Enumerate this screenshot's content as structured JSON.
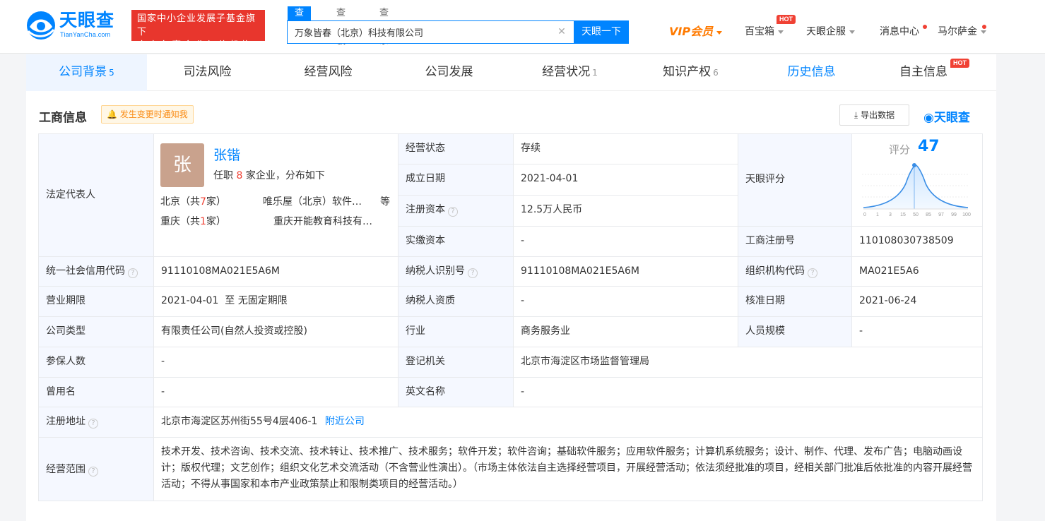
{
  "header": {
    "logo_text": "天眼查",
    "logo_sub": "TianYanCha.com",
    "badge_line1": "国家中小企业发展子基金旗下",
    "badge_line2": "官方备案企业征信机构",
    "search_tabs": [
      "查公司",
      "查老板",
      "查关系"
    ],
    "search_value": "万象皆春（北京）科技有限公司",
    "search_button": "天眼一下",
    "nav": {
      "vip": "VIP会员",
      "baibaoxiang": "百宝箱",
      "hot": "HOT",
      "qifu": "天眼企服",
      "messages": "消息中心",
      "user": "马尔萨金"
    }
  },
  "tabs": [
    {
      "label": "公司背景",
      "count": "5"
    },
    {
      "label": "司法风险",
      "count": ""
    },
    {
      "label": "经营风险",
      "count": ""
    },
    {
      "label": "公司发展",
      "count": ""
    },
    {
      "label": "经营状况",
      "count": "1"
    },
    {
      "label": "知识产权",
      "count": "6"
    },
    {
      "label": "历史信息",
      "count": ""
    },
    {
      "label": "自主信息",
      "count": ""
    }
  ],
  "section": {
    "title": "工商信息",
    "notify": "发生变更时通知我",
    "export": "导出数据",
    "brand": "天眼查"
  },
  "legal_rep": {
    "label": "法定代表人",
    "avatar_char": "张",
    "name": "张锴",
    "sub_pre": "任职",
    "sub_num": "8",
    "sub_post": "家企业，分布如下",
    "row1_city": "北京（共",
    "row1_num": "7",
    "row1_end": "家）",
    "row1_company": "唯乐屋（北京）软件…",
    "row1_more": "等",
    "row2_city": "重庆（共",
    "row2_num": "1",
    "row2_end": "家）",
    "row2_company": "重庆开能教育科技有…"
  },
  "fields": {
    "status_label": "经营状态",
    "status": "存续",
    "found_label": "成立日期",
    "found": "2021-04-01",
    "regcap_label": "注册资本",
    "regcap": "12.5万人民币",
    "paidcap_label": "实缴资本",
    "paidcap": "-",
    "score_label": "天眼评分",
    "score_word": "评分",
    "score": "47",
    "regno_label": "工商注册号",
    "regno": "110108030738509",
    "credit_label": "统一社会信用代码",
    "credit": "91110108MA021E5A6M",
    "taxid_label": "纳税人识别号",
    "taxid": "91110108MA021E5A6M",
    "orgcode_label": "组织机构代码",
    "orgcode": "MA021E5A6",
    "term_label": "营业期限",
    "term": "2021-04-01  至 无固定期限",
    "taxq_label": "纳税人资质",
    "taxq": "-",
    "approve_label": "核准日期",
    "approve": "2021-06-24",
    "type_label": "公司类型",
    "type": "有限责任公司(自然人投资或控股)",
    "industry_label": "行业",
    "industry": "商务服务业",
    "staff_label": "人员规模",
    "staff": "-",
    "insured_label": "参保人数",
    "insured": "-",
    "authority_label": "登记机关",
    "authority": "北京市海淀区市场监督管理局",
    "former_label": "曾用名",
    "former": "-",
    "english_label": "英文名称",
    "english": "-",
    "address_label": "注册地址",
    "address": "北京市海淀区苏州街55号4层406-1",
    "nearby": "附近公司",
    "scope_label": "经营范围",
    "scope": "技术开发、技术咨询、技术交流、技术转让、技术推广、技术服务；软件开发；软件咨询；基础软件服务；应用软件服务；计算机系统服务；设计、制作、代理、发布广告；电脑动画设计；版权代理；文艺创作；组织文化艺术交流活动（不含营业性演出）。（市场主体依法自主选择经营项目，开展经营活动；依法须经批准的项目，经相关部门批准后依批准的内容开展经营活动；不得从事国家和本市产业政策禁止和限制类项目的经营活动。）"
  },
  "score_chart": {
    "ticks": [
      "0",
      "1",
      "3",
      "15",
      "50",
      "85",
      "97",
      "99",
      "100"
    ],
    "marker_value": 47
  },
  "colors": {
    "brand_blue": "#0084ff",
    "badge_red": "#e8362d",
    "vip_orange": "#ff7a00",
    "label_bg": "#f5f8ff"
  }
}
